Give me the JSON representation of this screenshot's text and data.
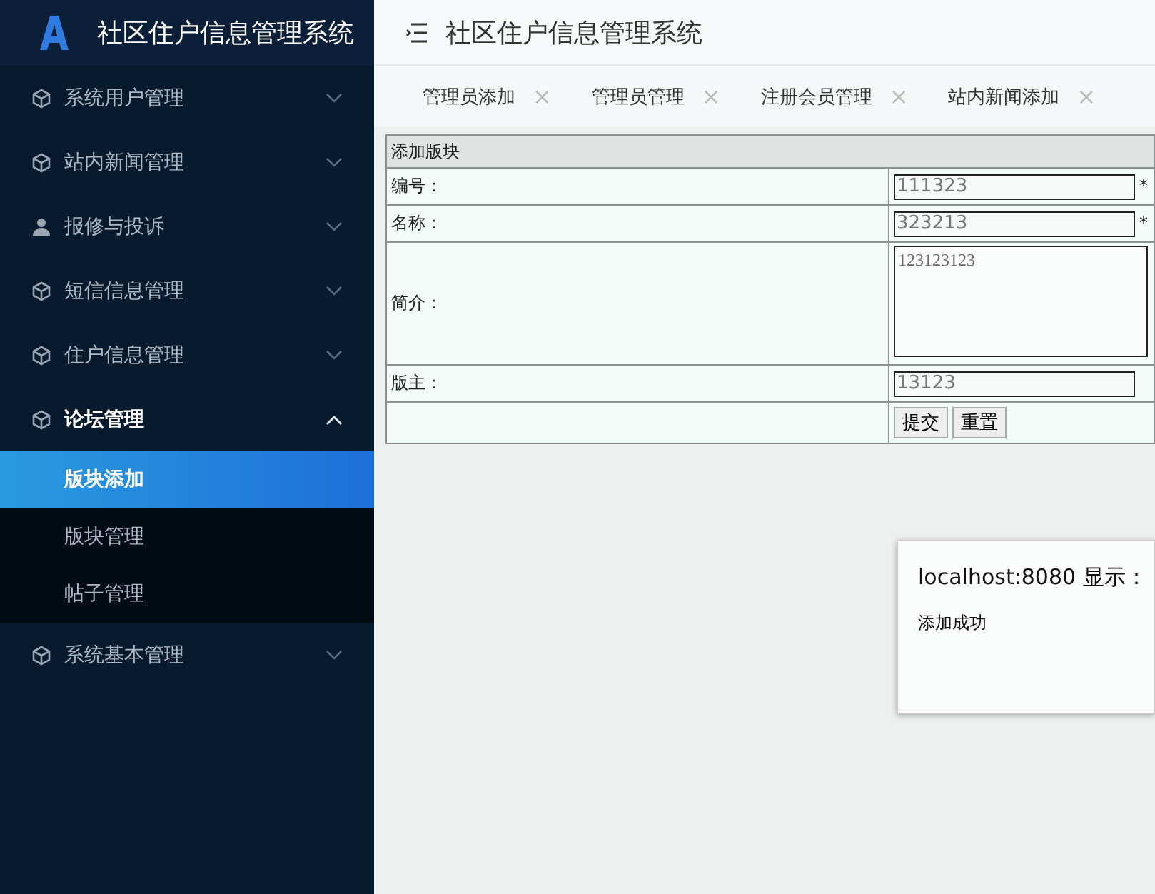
{
  "sidebar": {
    "title": "社区住户信息管理系统",
    "items": [
      {
        "label": "系统用户管理",
        "kind": "cube",
        "expanded": false
      },
      {
        "label": "站内新闻管理",
        "kind": "cube",
        "expanded": false
      },
      {
        "label": "报修与投诉",
        "kind": "user",
        "expanded": false
      },
      {
        "label": "短信信息管理",
        "kind": "cube",
        "expanded": false
      },
      {
        "label": "住户信息管理",
        "kind": "cube",
        "expanded": false
      },
      {
        "label": "论坛管理",
        "kind": "cube",
        "expanded": true,
        "children": [
          {
            "label": "版块添加",
            "selected": true
          },
          {
            "label": "版块管理",
            "selected": false
          },
          {
            "label": "帖子管理",
            "selected": false
          }
        ]
      },
      {
        "label": "系统基本管理",
        "kind": "cube",
        "expanded": false
      }
    ]
  },
  "header": {
    "title": "社区住户信息管理系统"
  },
  "tabs": [
    {
      "label": "管理员添加",
      "close": "×"
    },
    {
      "label": "管理员管理",
      "close": "×"
    },
    {
      "label": "注册会员管理",
      "close": "×"
    },
    {
      "label": "站内新闻添加",
      "close": "×"
    }
  ],
  "form": {
    "title": "添加版块",
    "rows": [
      {
        "kind": "input",
        "label": "编号：",
        "value": "111323",
        "required": "*"
      },
      {
        "kind": "input",
        "label": "名称：",
        "value": "323213",
        "required": "*"
      },
      {
        "kind": "textarea",
        "label": "简介：",
        "value": "123123123"
      },
      {
        "kind": "input",
        "label": "版主：",
        "value": "13123"
      },
      {
        "kind": "buttons",
        "buttons": [
          "提交",
          "重置"
        ]
      }
    ]
  },
  "dialog": {
    "title": "localhost:8080 显示：",
    "message": "添加成功"
  }
}
